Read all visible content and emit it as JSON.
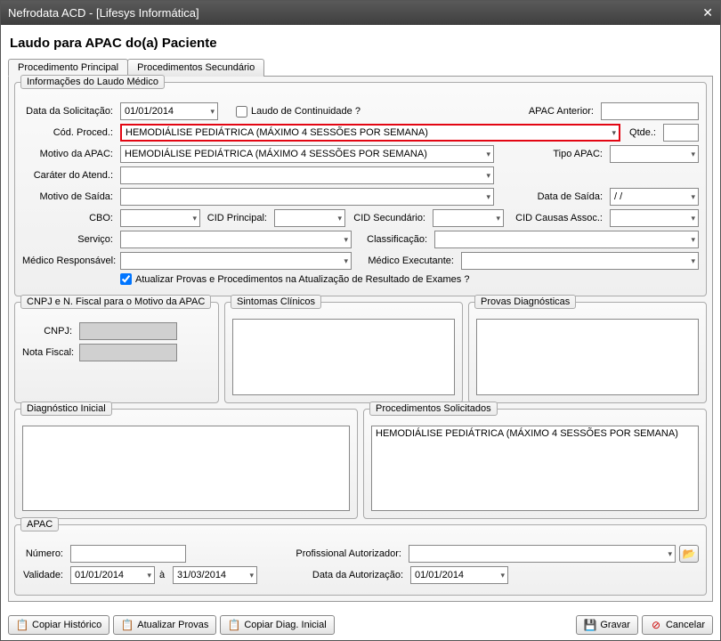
{
  "window": {
    "title": "Nefrodata ACD - [Lifesys Informática]"
  },
  "page": {
    "title": "Laudo para APAC do(a) Paciente"
  },
  "tabs": {
    "primary": "Procedimento Principal",
    "secondary": "Procedimentos Secundário"
  },
  "group_info_title": "Informações do Laudo Médico",
  "labels": {
    "data_solicitacao": "Data da Solicitação:",
    "laudo_continuidade": "Laudo de Continuidade ?",
    "apac_anterior": "APAC Anterior:",
    "cod_proced": "Cód. Proced.:",
    "qtde": "Qtde.:",
    "motivo_apac": "Motivo da APAC:",
    "tipo_apac": "Tipo APAC:",
    "carater_atend": "Caráter do Atend.:",
    "motivo_saida": "Motivo de Saída:",
    "data_saida": "Data de Saída:",
    "cbo": "CBO:",
    "cid_principal": "CID Principal:",
    "cid_secundario": "CID Secundário:",
    "cid_causas": "CID Causas Assoc.:",
    "servico": "Serviço:",
    "classificacao": "Classificação:",
    "medico_responsavel": "Médico Responsável:",
    "medico_executante": "Médico Executante:",
    "atualizar_provas": "Atualizar Provas e Procedimentos na Atualização de Resultado de Exames ?"
  },
  "values": {
    "data_solicitacao": "01/01/2014",
    "cod_proced": "HEMODIÁLISE PEDIÁTRICA (MÁXIMO 4 SESSÕES POR SEMANA)",
    "motivo_apac": "HEMODIÁLISE PEDIÁTRICA (MÁXIMO 4 SESSÕES POR SEMANA)",
    "data_saida": "/   /"
  },
  "group_cnpj": {
    "title": "CNPJ e N. Fiscal para o Motivo da APAC",
    "cnpj_label": "CNPJ:",
    "nota_fiscal_label": "Nota Fiscal:"
  },
  "group_sintomas_title": "Sintomas Clínicos",
  "group_provas_title": "Provas Diagnósticas",
  "group_diag_inicial_title": "Diagnóstico Inicial",
  "group_proc_solicitados": {
    "title": "Procedimentos Solicitados",
    "item1": "HEMODIÁLISE PEDIÁTRICA (MÁXIMO 4 SESSÕES POR SEMANA)"
  },
  "group_apac": {
    "title": "APAC",
    "numero": "Número:",
    "prof_autorizador": "Profissional Autorizador:",
    "validade": "Validade:",
    "a": "à",
    "data_autorizacao": "Data da Autorização:",
    "validade_ini": "01/01/2014",
    "validade_fim": "31/03/2014",
    "data_autorizacao_val": "01/01/2014"
  },
  "buttons": {
    "copiar_historico": "Copiar Histórico",
    "atualizar_provas": "Atualizar Provas",
    "copiar_diag": "Copiar Diag. Inicial",
    "gravar": "Gravar",
    "cancelar": "Cancelar"
  }
}
